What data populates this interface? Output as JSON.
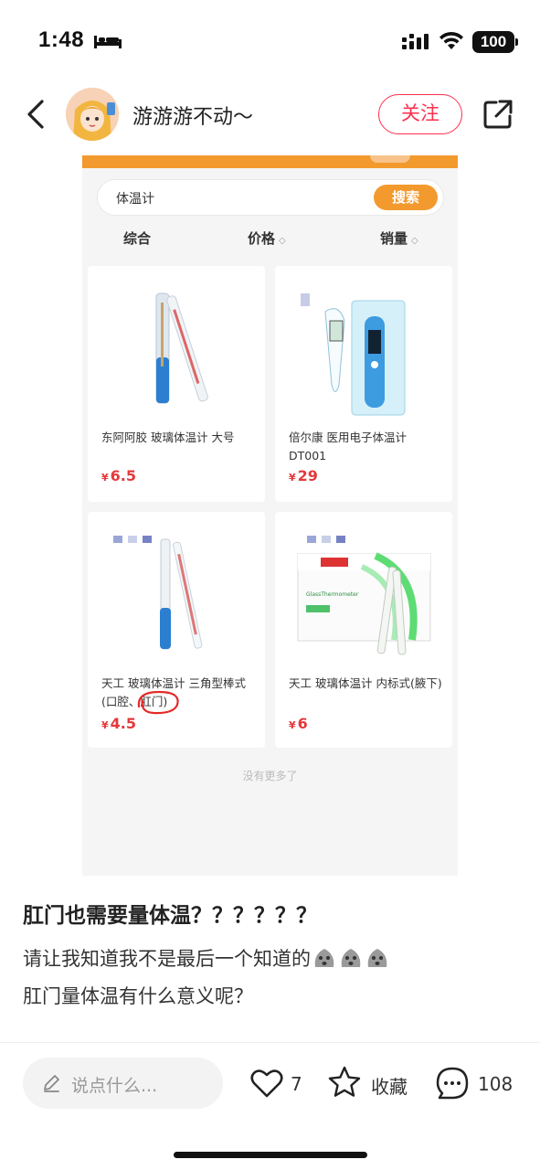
{
  "status_bar": {
    "time": "1:48",
    "battery": "100"
  },
  "header": {
    "author": "游游游不动～",
    "follow_label": "关注"
  },
  "embedded": {
    "search_query": "体温计",
    "search_button": "搜索",
    "sort_tabs": [
      "综合",
      "价格",
      "销量"
    ],
    "products": [
      {
        "title": "东阿阿胶 玻璃体温计 大号",
        "currency": "¥",
        "price": "6.5"
      },
      {
        "title": "倍尔康 医用电子体温计 DT001",
        "currency": "¥",
        "price": "29"
      },
      {
        "title": "天工 玻璃体温计 三角型棒式 (口腔、肛门)",
        "currency": "¥",
        "price": "4.5"
      },
      {
        "title": "天工 玻璃体温计 内标式(腋下)",
        "currency": "¥",
        "price": "6"
      }
    ],
    "no_more": "没有更多了"
  },
  "post": {
    "title": "肛门也需要量体温？？？？？？",
    "line1": "请让我知道我不是最后一个知道的",
    "line2": "肛门量体温有什么意义呢？"
  },
  "bottom_bar": {
    "comment_placeholder": "说点什么...",
    "likes": "7",
    "collect_label": "收藏",
    "comments": "108"
  },
  "colors": {
    "accent_red": "#ff2e4d",
    "orange": "#f39a2e",
    "price_red": "#e4393c"
  }
}
